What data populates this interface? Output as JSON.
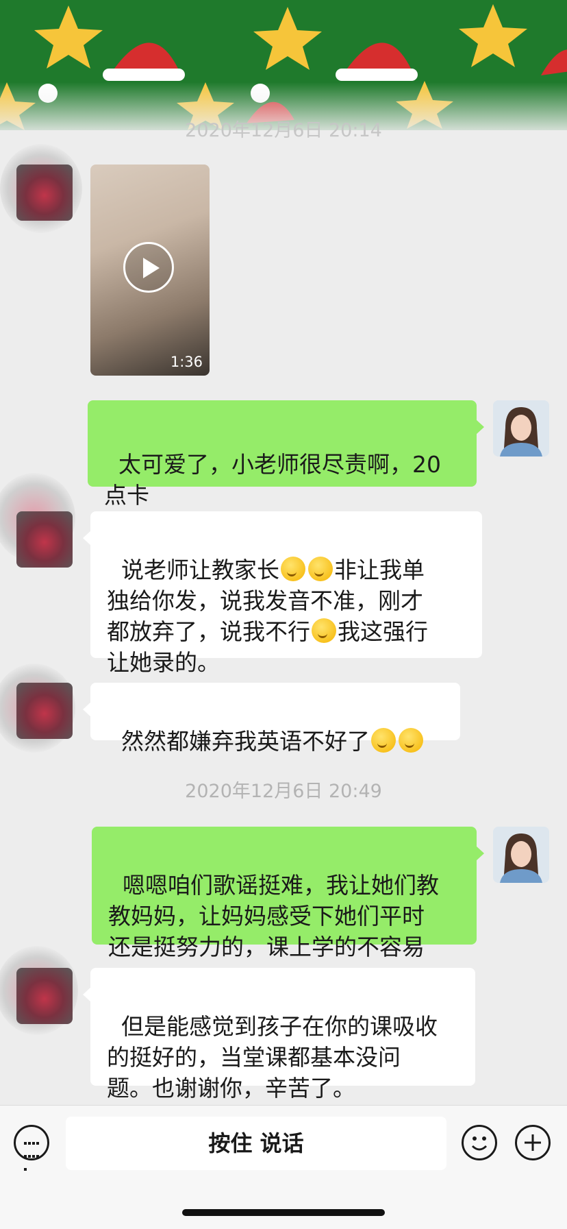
{
  "timestamps": {
    "top_partial": "2020年12月6日 20:14",
    "second": "2020年12月6日 20:49"
  },
  "video": {
    "duration": "1:36"
  },
  "messages": [
    {
      "side": "right",
      "text": "太可爱了，小老师很尽责啊，20\n点卡"
    },
    {
      "side": "left",
      "parts": [
        "说老师让教家长",
        "非让我单\n独给你发，说我发音不准，刚才\n都放弃了，说我不行",
        "我这强行\n让她录的。"
      ]
    },
    {
      "side": "left",
      "parts": [
        "然然都嫌弃我英语不好了"
      ]
    },
    {
      "side": "right",
      "text": "嗯嗯咱们歌谣挺难，我让她们教\n教妈妈，让妈妈感受下她们平时\n还是挺努力的，课上学的不容易"
    },
    {
      "side": "left",
      "text": "但是能感觉到孩子在你的课吸收\n的挺好的，当堂课都基本没问\n题。也谢谢你，辛苦了。"
    }
  ],
  "input_bar": {
    "voice_label": "按住 说话",
    "left_icon": "keyboard-icon",
    "emoji_icon": "smiley-icon",
    "plus_icon": "plus-icon"
  },
  "colors": {
    "background": "#ededed",
    "bubble_green": "#95ec69",
    "bubble_white": "#ffffff"
  },
  "emoji_name": "thinking-face-emoji"
}
